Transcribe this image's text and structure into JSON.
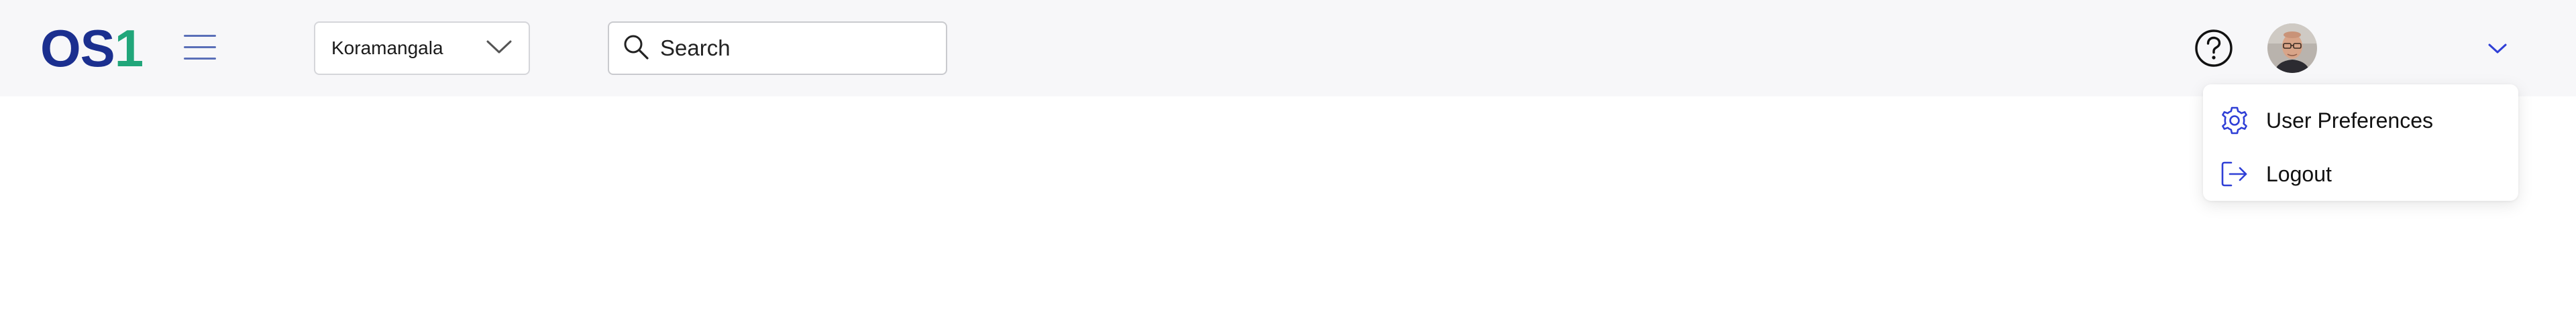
{
  "header": {
    "logo": {
      "part1": "OS",
      "part2": "1"
    },
    "location_select": {
      "value": "Koramangala"
    },
    "search": {
      "placeholder": "Search",
      "value": ""
    },
    "user": {
      "name": ""
    }
  },
  "user_menu": {
    "items": [
      {
        "label": "User Preferences",
        "icon": "gear-icon"
      },
      {
        "label": "Logout",
        "icon": "logout-icon"
      }
    ]
  },
  "colors": {
    "brand_blue": "#1b2f8f",
    "brand_green": "#21a67a",
    "accent": "#2f3fd6",
    "topbar_bg": "#f7f7f9"
  }
}
